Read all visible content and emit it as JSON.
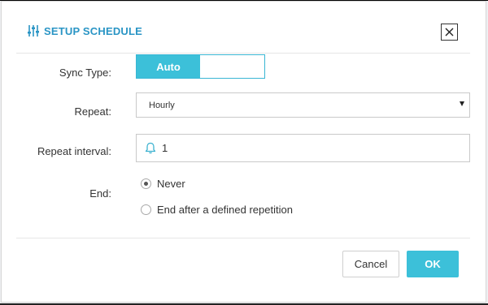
{
  "dialog": {
    "title": "SETUP SCHEDULE",
    "title_icon": "sliders-icon",
    "close_icon": "close-icon"
  },
  "form": {
    "sync_type": {
      "label": "Sync Type:",
      "selected": "Auto"
    },
    "repeat": {
      "label": "Repeat:",
      "value": "Hourly"
    },
    "repeat_interval": {
      "label": "Repeat interval:",
      "icon": "bell-icon",
      "value": "1"
    },
    "end": {
      "label": "End:",
      "options": [
        {
          "label": "Never",
          "checked": true
        },
        {
          "label": "End after a defined repetition",
          "checked": false
        }
      ]
    }
  },
  "footer": {
    "cancel_label": "Cancel",
    "ok_label": "OK"
  },
  "colors": {
    "accent": "#3cc0d9",
    "title": "#2a95c5"
  }
}
